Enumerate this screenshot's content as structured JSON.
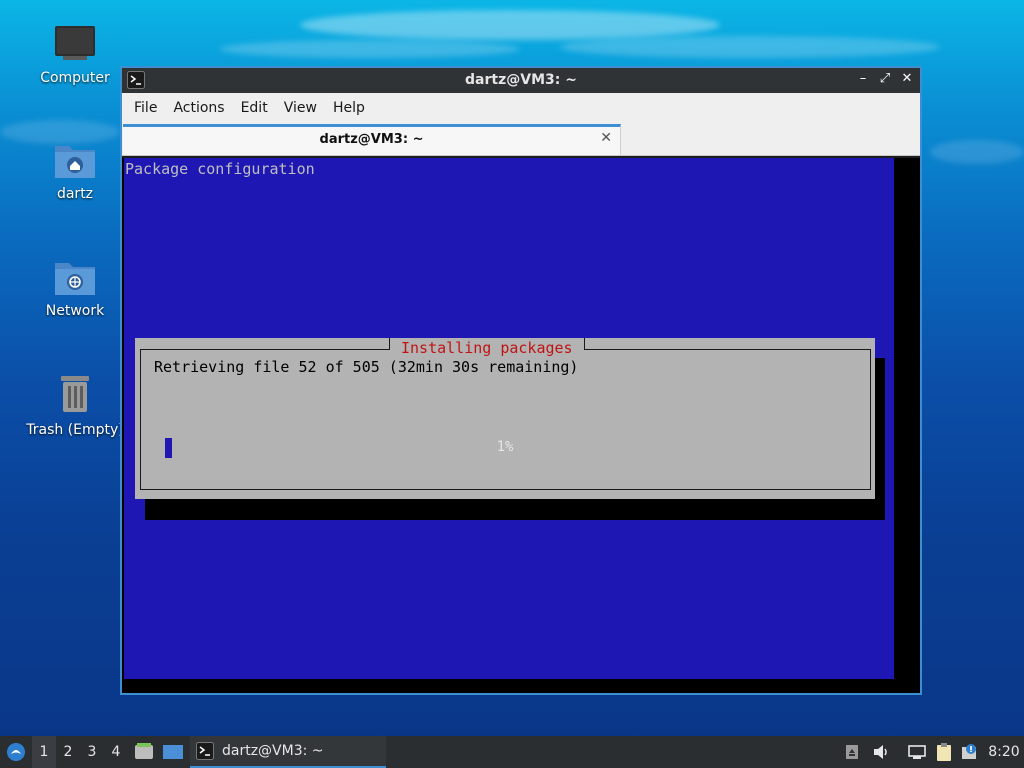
{
  "desktop": {
    "icons": [
      {
        "label": "Computer"
      },
      {
        "label": "dartz"
      },
      {
        "label": "Network"
      },
      {
        "label": "Trash (Empty)"
      }
    ]
  },
  "window": {
    "title": "dartz@VM3: ~",
    "controls": {
      "minimize": "–",
      "maximize": "⤢",
      "close": "✕"
    },
    "menu": [
      "File",
      "Actions",
      "Edit",
      "View",
      "Help"
    ],
    "tab": {
      "label": "dartz@VM3: ~",
      "close": "✕"
    }
  },
  "terminal": {
    "heading": "Package configuration",
    "dialog": {
      "title": "Installing packages",
      "message": "Retrieving file 52 of 505 (32min 30s remaining)",
      "progress_percent": 1,
      "progress_label": "1%"
    }
  },
  "taskbar": {
    "workspaces": [
      "1",
      "2",
      "3",
      "4"
    ],
    "active_workspace": "1",
    "task_label": "dartz@VM3: ~",
    "clock": "8:20"
  },
  "colors": {
    "dialog_title": "#c01414",
    "term_blue": "#1f17b4",
    "accent": "#3d8fd1"
  }
}
